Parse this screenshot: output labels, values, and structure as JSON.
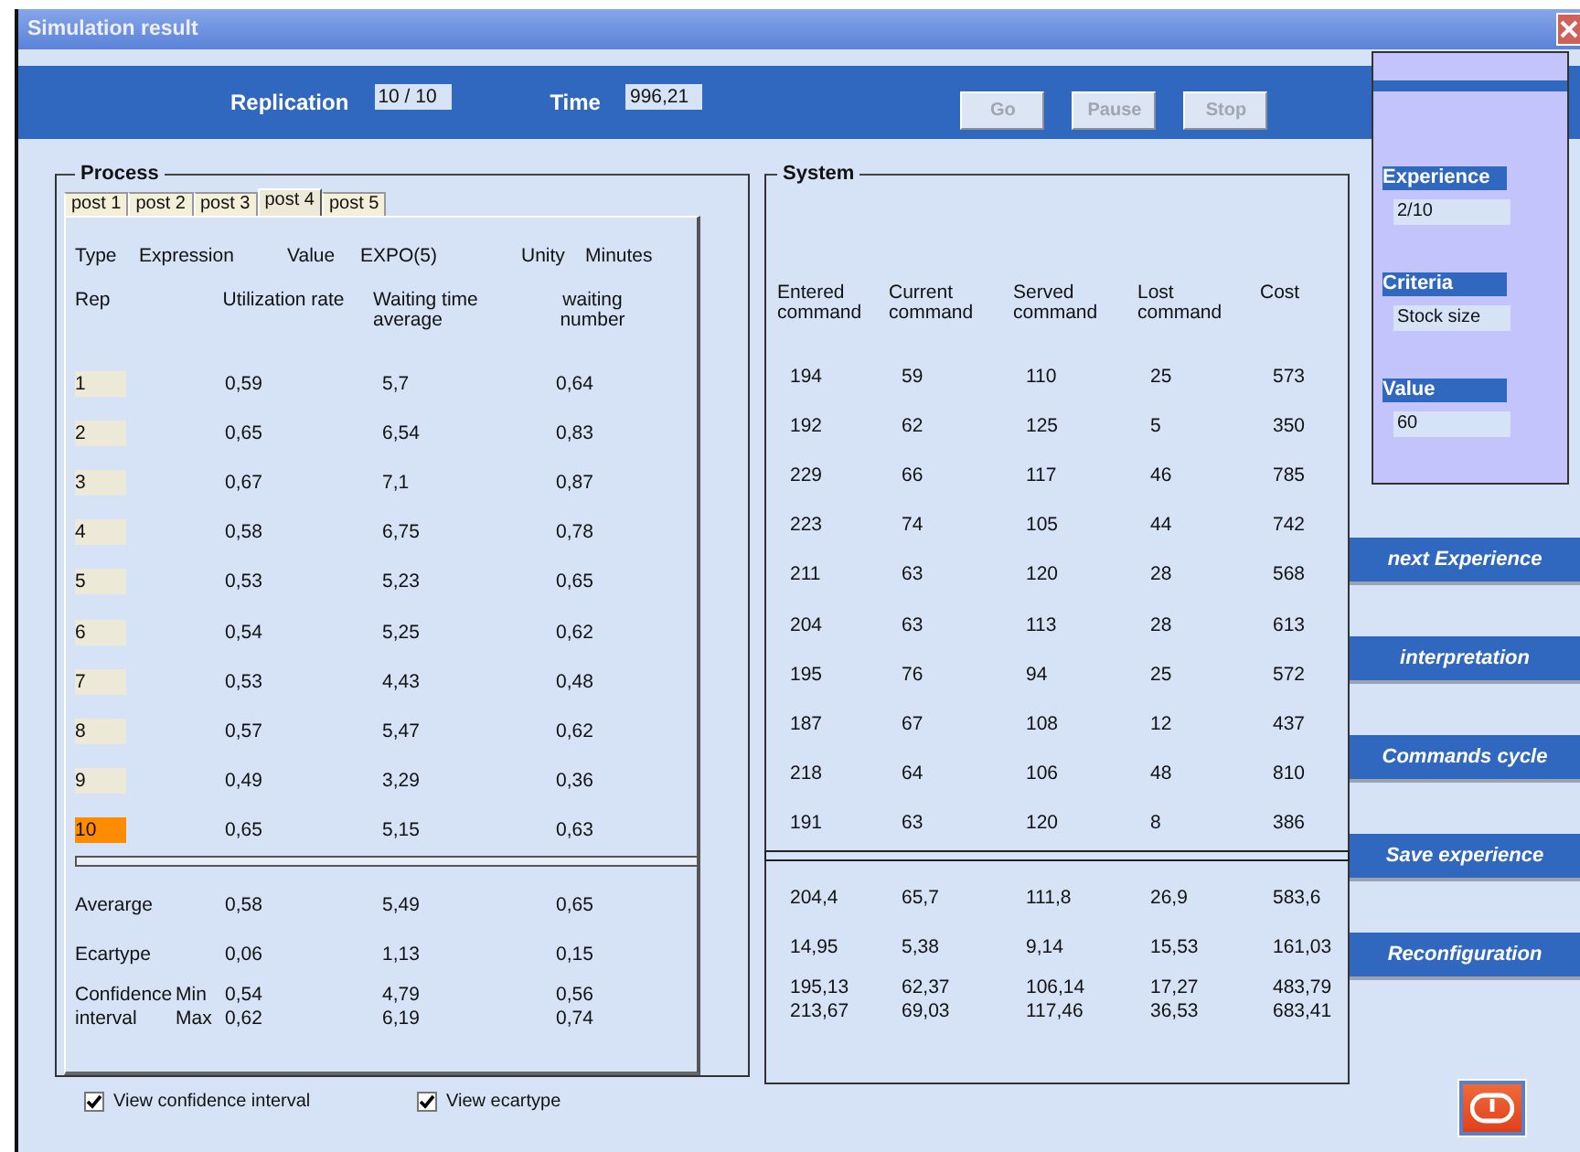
{
  "window": {
    "title": "Simulation result"
  },
  "toolbar": {
    "replication_label": "Replication",
    "replication": "10 / 10",
    "time_label": "Time",
    "time": "996,21",
    "buttons": [
      {
        "label": "Go",
        "disabled": true
      },
      {
        "label": "Pause",
        "disabled": true
      },
      {
        "label": "Stop",
        "disabled": true
      }
    ]
  },
  "process": {
    "title": "Process",
    "tabs": [
      {
        "label": "post 1",
        "selected": false
      },
      {
        "label": "post 2",
        "selected": false
      },
      {
        "label": "post 3",
        "selected": false
      },
      {
        "label": "post 4",
        "selected": true
      },
      {
        "label": "post 5",
        "selected": false
      }
    ],
    "info": [
      "Type",
      "Expression",
      "Value",
      "EXPO(5)",
      "Unity",
      "Minutes"
    ],
    "columns": [
      "Rep",
      "Utilization rate",
      "Waiting time average",
      "waiting number"
    ],
    "rows": [
      {
        "rep": "1",
        "selected": false,
        "values": [
          "0,59",
          "5,7",
          "0,64"
        ]
      },
      {
        "rep": "2",
        "selected": false,
        "values": [
          "0,65",
          "6,54",
          "0,83"
        ]
      },
      {
        "rep": "3",
        "selected": false,
        "values": [
          "0,67",
          "7,1",
          "0,87"
        ]
      },
      {
        "rep": "4",
        "selected": false,
        "values": [
          "0,58",
          "6,75",
          "0,78"
        ]
      },
      {
        "rep": "5",
        "selected": false,
        "values": [
          "0,53",
          "5,23",
          "0,65"
        ]
      },
      {
        "rep": "6",
        "selected": false,
        "values": [
          "0,54",
          "5,25",
          "0,62"
        ]
      },
      {
        "rep": "7",
        "selected": false,
        "values": [
          "0,53",
          "4,43",
          "0,48"
        ]
      },
      {
        "rep": "8",
        "selected": false,
        "values": [
          "0,57",
          "5,47",
          "0,62"
        ]
      },
      {
        "rep": "9",
        "selected": false,
        "values": [
          "0,49",
          "3,29",
          "0,36"
        ]
      },
      {
        "rep": "10",
        "selected": true,
        "values": [
          "0,65",
          "5,15",
          "0,63"
        ]
      }
    ],
    "summary": [
      {
        "kind": "single",
        "label": "Averarge",
        "values": [
          "0,58",
          "5,49",
          "0,65"
        ]
      },
      {
        "kind": "single",
        "label": "Ecartype",
        "values": [
          "0,06",
          "1,13",
          "0,15"
        ]
      },
      {
        "kind": "interval",
        "label": "Confidence interval",
        "min_label": "Min",
        "max_label": "Max",
        "min": [
          "0,54",
          "4,79",
          "0,56"
        ],
        "max": [
          "0,62",
          "6,19",
          "0,74"
        ]
      }
    ]
  },
  "system": {
    "title": "System",
    "columns": [
      "Entered command",
      "Current command",
      "Served command",
      "Lost command",
      "Cost"
    ],
    "rows": [
      [
        "194",
        "59",
        "110",
        "25",
        "573"
      ],
      [
        "192",
        "62",
        "125",
        "5",
        "350"
      ],
      [
        "229",
        "66",
        "117",
        "46",
        "785"
      ],
      [
        "223",
        "74",
        "105",
        "44",
        "742"
      ],
      [
        "211",
        "63",
        "120",
        "28",
        "568"
      ],
      [
        "204",
        "63",
        "113",
        "28",
        "613"
      ],
      [
        "195",
        "76",
        "94",
        "25",
        "572"
      ],
      [
        "187",
        "67",
        "108",
        "12",
        "437"
      ],
      [
        "218",
        "64",
        "106",
        "48",
        "810"
      ],
      [
        "191",
        "63",
        "120",
        "8",
        "386"
      ]
    ],
    "summary": [
      {
        "kind": "single",
        "values": [
          "204,4",
          "65,7",
          "111,8",
          "26,9",
          "583,6"
        ]
      },
      {
        "kind": "single",
        "values": [
          "14,95",
          "5,38",
          "9,14",
          "15,53",
          "161,03"
        ]
      },
      {
        "kind": "interval",
        "min": [
          "195,13",
          "62,37",
          "106,14",
          "17,27",
          "483,79"
        ],
        "max": [
          "213,67",
          "69,03",
          "117,46",
          "36,53",
          "683,41"
        ]
      }
    ]
  },
  "experience_panel": [
    {
      "label": "Experience",
      "value": "2/10"
    },
    {
      "label": "Criteria",
      "value": "Stock size"
    },
    {
      "label": "Value",
      "value": "60"
    }
  ],
  "actions": [
    "next Experience",
    "interpretation",
    "Commands cycle",
    "Save experience",
    "Reconfiguration"
  ],
  "options": [
    {
      "label": "View confidence interval",
      "checked": true
    },
    {
      "label": "View ecartype",
      "checked": true
    }
  ]
}
